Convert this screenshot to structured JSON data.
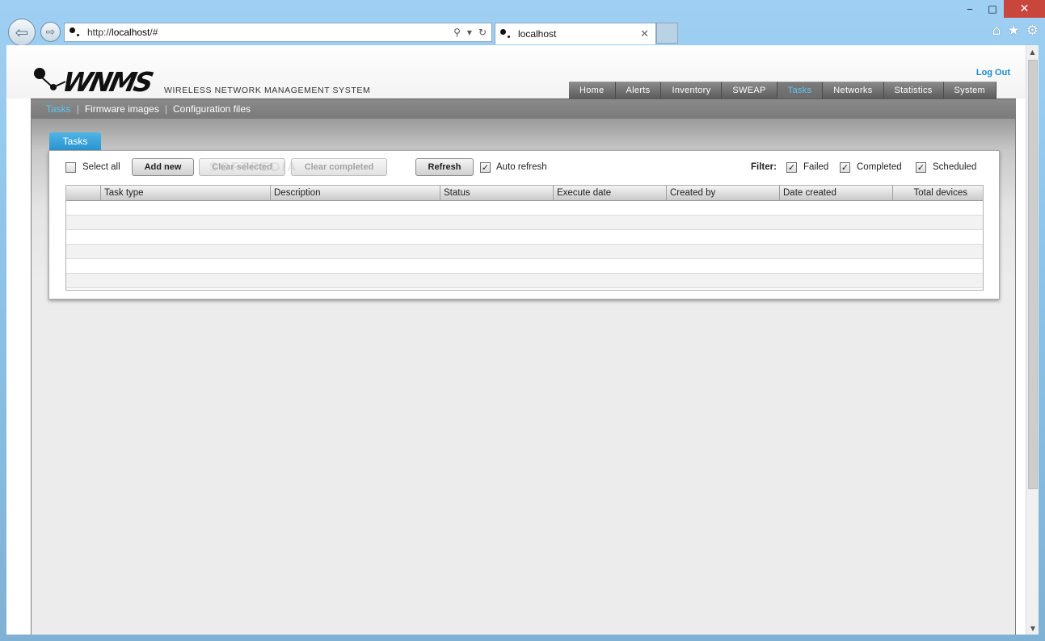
{
  "browser": {
    "url_prefix": "http://",
    "url_host": "localhost",
    "url_suffix": "/#",
    "tab_title": "localhost",
    "back_glyph": "⇦",
    "forward_glyph": "⇨",
    "search_glyph": "⚲",
    "dropdown_glyph": "▾",
    "refresh_glyph": "↻",
    "close_tab_glyph": "✕",
    "minimize_glyph": "‒",
    "maximize_glyph": "□",
    "close_glyph": "✕",
    "home_glyph": "⌂",
    "favorites_glyph": "★",
    "tools_glyph": "⚙",
    "scroll_up_glyph": "▲",
    "scroll_down_glyph": "▼"
  },
  "app": {
    "logo_text": "WNMS",
    "subtitle": "WIRELESS NETWORK MANAGEMENT SYSTEM",
    "logout_label": "Log Out",
    "main_tabs": [
      {
        "label": "Home",
        "active": false
      },
      {
        "label": "Alerts",
        "active": false
      },
      {
        "label": "Inventory",
        "active": false
      },
      {
        "label": "SWEAP",
        "active": false
      },
      {
        "label": "Tasks",
        "active": true
      },
      {
        "label": "Networks",
        "active": false
      },
      {
        "label": "Statistics",
        "active": false
      },
      {
        "label": "System",
        "active": false
      }
    ],
    "subnav": [
      {
        "label": "Tasks",
        "active": true
      },
      {
        "label": "Firmware images",
        "active": false
      },
      {
        "label": "Configuration files",
        "active": false
      }
    ],
    "subnav_separator": "|"
  },
  "tasks_panel": {
    "tab_label": "Tasks",
    "select_all_label": "Select all",
    "add_new_label": "Add new",
    "clear_selected_label": "Clear selected",
    "clear_completed_label": "Clear completed",
    "refresh_label": "Refresh",
    "auto_refresh_label": "Auto refresh",
    "auto_refresh_checked": true,
    "filter_label": "Filter:",
    "filters": [
      {
        "label": "Failed",
        "checked": true
      },
      {
        "label": "Completed",
        "checked": true
      },
      {
        "label": "Scheduled",
        "checked": true
      }
    ],
    "check_glyph": "✓",
    "watermark": "SOFTPEDIA",
    "columns": [
      "",
      "Task type",
      "Description",
      "Status",
      "Execute date",
      "Created by",
      "Date created",
      "Total devices"
    ],
    "rows": []
  }
}
